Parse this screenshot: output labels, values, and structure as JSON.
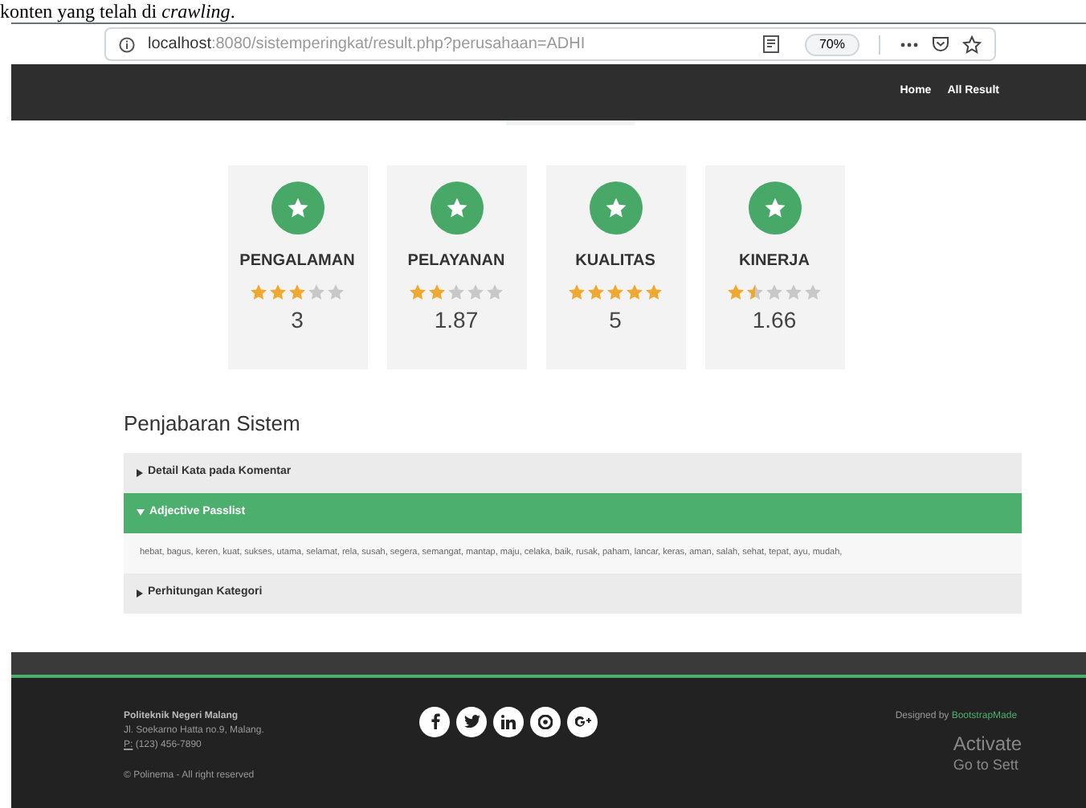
{
  "document_caption": "konten yang telah di *crawling*.",
  "browser": {
    "url_host": "localhost",
    "url_rest": ":8080/sistemperingkat/result.php?perusahaan=ADHI",
    "zoom": "70%"
  },
  "nav": [
    {
      "label": "Home"
    },
    {
      "label": "All Result"
    }
  ],
  "scores": [
    {
      "title": "PENGALAMAN",
      "stars": 3,
      "value": "3"
    },
    {
      "title": "PELAYANAN",
      "stars": 2,
      "value": "1.87"
    },
    {
      "title": "KUALITAS",
      "stars": 5,
      "value": "5"
    },
    {
      "title": "KINERJA",
      "stars": 1.5,
      "value": "1.66"
    }
  ],
  "section_title": "Penjabaran Sistem",
  "accordion": [
    {
      "title": "Detail Kata pada Komentar",
      "expanded": false
    },
    {
      "title": "Adjective Passlist",
      "expanded": true,
      "body": "hebat, bagus, keren, kuat, sukses, utama, selamat, rela, susah, segera, semangat, mantap, maju, celaka, baik, rusak, paham, lancar, keras, aman, salah, sehat, tepat, ayu, mudah,"
    },
    {
      "title": "Perhitungan Kategori",
      "expanded": false
    }
  ],
  "footer": {
    "org": "Politeknik Negeri Malang",
    "address": "Jl. Soekarno Hatta no.9, Malang.",
    "phone_label": "P:",
    "phone": "(123) 456-7890",
    "copyright": "© Polinema - All right reserved",
    "designed_by": "Designed by",
    "designer": "BootstrapMade"
  },
  "os_overlay": {
    "line1": "Activate",
    "line2": "Go to Sett"
  }
}
